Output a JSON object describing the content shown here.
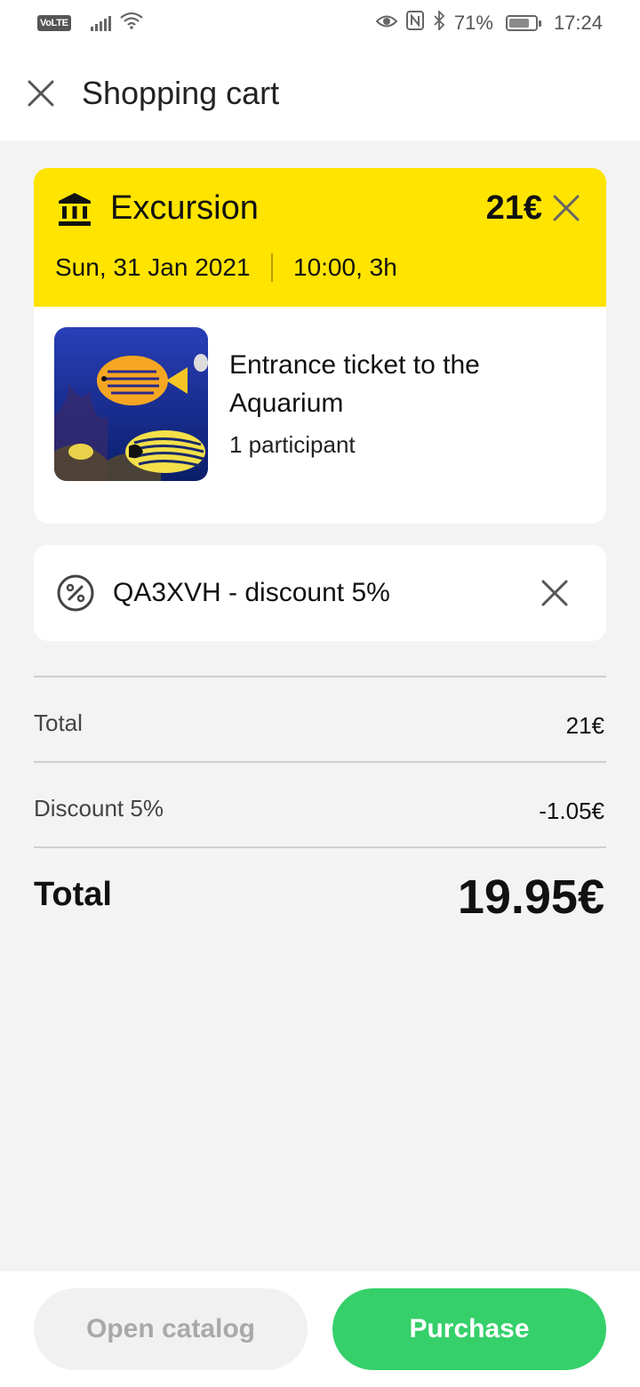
{
  "status_bar": {
    "network_badge": "VoLTE",
    "battery_percent": "71%",
    "time": "17:24",
    "icons": [
      "signal-icon",
      "wifi-icon",
      "eye-icon",
      "nfc-icon",
      "bluetooth-icon",
      "battery-icon"
    ]
  },
  "header": {
    "title": "Shopping cart",
    "close_icon": "close-icon"
  },
  "cart_item": {
    "type_icon": "museum-icon",
    "type_label": "Excursion",
    "price": "21€",
    "date": "Sun, 31 Jan 2021",
    "time": "10:00, 3h",
    "title": "Entrance ticket to the Aquarium",
    "participants": "1 participant",
    "accent_color": "#ffe400"
  },
  "discount": {
    "icon": "percent-icon",
    "code_text": "QA3XVH - discount 5%"
  },
  "summary": {
    "subtotal_label": "Total",
    "subtotal_value": "21€",
    "discount_label": "Discount 5%",
    "discount_value": "-1.05€",
    "total_label": "Total",
    "total_value": "19.95€"
  },
  "actions": {
    "open_catalog_label": "Open catalog",
    "purchase_label": "Purchase",
    "primary_color": "#35d06a"
  }
}
